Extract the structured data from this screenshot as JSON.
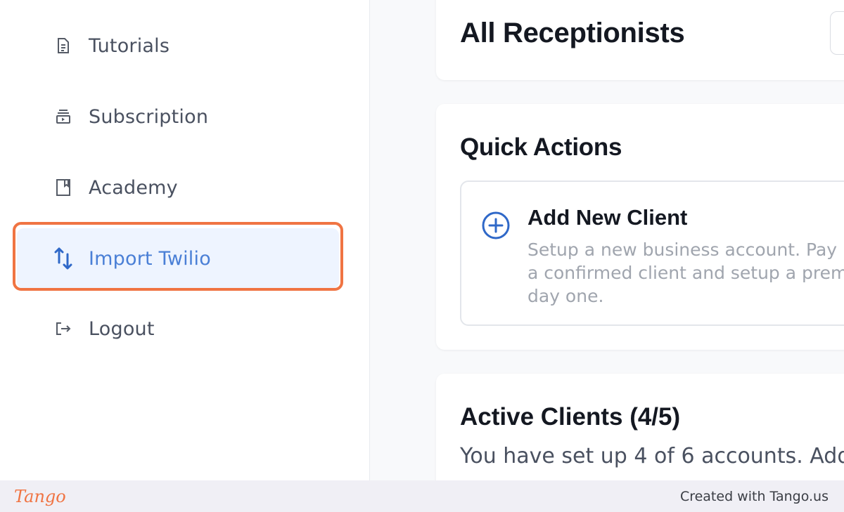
{
  "sidebar": {
    "items": [
      {
        "label": "Tutorials",
        "icon": "document-icon"
      },
      {
        "label": "Subscription",
        "icon": "subscription-icon"
      },
      {
        "label": "Academy",
        "icon": "book-icon"
      },
      {
        "label": "Import Twilio",
        "icon": "swap-vertical-icon",
        "active": true
      },
      {
        "label": "Logout",
        "icon": "logout-icon"
      }
    ]
  },
  "main": {
    "page_title": "All Receptionists",
    "quick_actions": {
      "title": "Quick Actions",
      "add_client": {
        "title": "Add New Client",
        "description": "Setup a new business account. Pay\na confirmed client and setup a prem\nday one."
      }
    },
    "active_clients": {
      "title": "Active Clients (4/5)",
      "description": "You have set up 4 of 6 accounts. Add"
    }
  },
  "footer": {
    "logo": "Tango",
    "credit": "Created with Tango.us"
  },
  "colors": {
    "accent": "#2f68c8",
    "highlight": "#f07443",
    "active_bg": "#eef4ff"
  }
}
